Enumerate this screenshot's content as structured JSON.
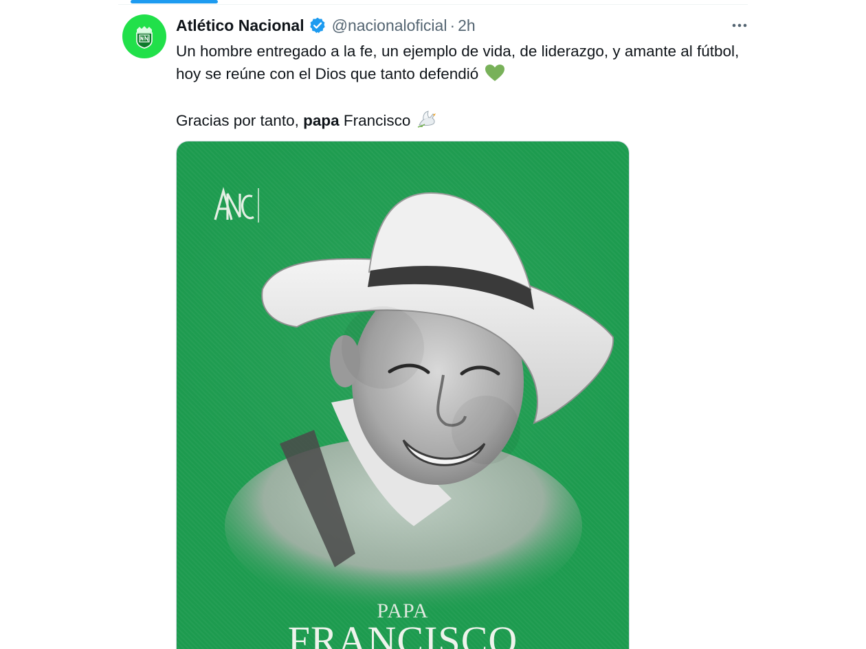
{
  "account": {
    "display_name": "Atlético Nacional",
    "handle": "@nacionaloficial",
    "separator": "·",
    "timestamp": "2h",
    "avatar_icon": "atletico-nacional-crest-icon",
    "avatar_color": "#21e04a"
  },
  "tweet": {
    "line1": "Un hombre entregado a la fe, un ejemplo de vida, de liderazgo, y amante al fútbol, hoy se reúne con el Dios que tanto defendió",
    "line2_prefix": "Gracias por tanto,",
    "line2_bold": "papa",
    "line2_suffix": "Francisco",
    "emoji_1": "green-heart",
    "emoji_2": "dove"
  },
  "media": {
    "caption_small": "PAPA",
    "caption_large": "FRANCISCO",
    "background_color": "#1d9b4f"
  },
  "colors": {
    "accent": "#1d9bf0",
    "secondary_text": "#536471",
    "verified": "#1d9bf0"
  }
}
